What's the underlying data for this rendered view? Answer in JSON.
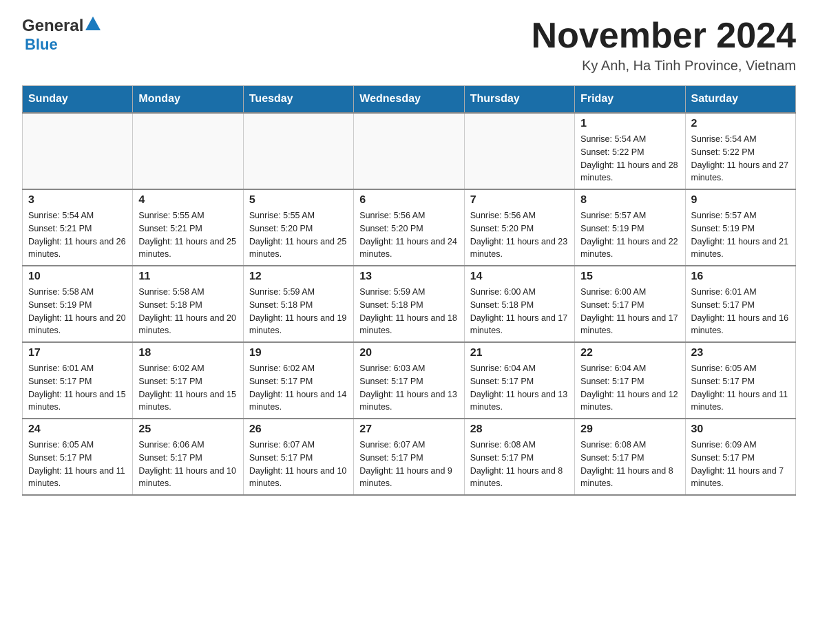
{
  "logo": {
    "general": "General",
    "blue": "Blue"
  },
  "header": {
    "month": "November 2024",
    "location": "Ky Anh, Ha Tinh Province, Vietnam"
  },
  "weekdays": [
    "Sunday",
    "Monday",
    "Tuesday",
    "Wednesday",
    "Thursday",
    "Friday",
    "Saturday"
  ],
  "weeks": [
    [
      {
        "day": "",
        "info": ""
      },
      {
        "day": "",
        "info": ""
      },
      {
        "day": "",
        "info": ""
      },
      {
        "day": "",
        "info": ""
      },
      {
        "day": "",
        "info": ""
      },
      {
        "day": "1",
        "info": "Sunrise: 5:54 AM\nSunset: 5:22 PM\nDaylight: 11 hours and 28 minutes."
      },
      {
        "day": "2",
        "info": "Sunrise: 5:54 AM\nSunset: 5:22 PM\nDaylight: 11 hours and 27 minutes."
      }
    ],
    [
      {
        "day": "3",
        "info": "Sunrise: 5:54 AM\nSunset: 5:21 PM\nDaylight: 11 hours and 26 minutes."
      },
      {
        "day": "4",
        "info": "Sunrise: 5:55 AM\nSunset: 5:21 PM\nDaylight: 11 hours and 25 minutes."
      },
      {
        "day": "5",
        "info": "Sunrise: 5:55 AM\nSunset: 5:20 PM\nDaylight: 11 hours and 25 minutes."
      },
      {
        "day": "6",
        "info": "Sunrise: 5:56 AM\nSunset: 5:20 PM\nDaylight: 11 hours and 24 minutes."
      },
      {
        "day": "7",
        "info": "Sunrise: 5:56 AM\nSunset: 5:20 PM\nDaylight: 11 hours and 23 minutes."
      },
      {
        "day": "8",
        "info": "Sunrise: 5:57 AM\nSunset: 5:19 PM\nDaylight: 11 hours and 22 minutes."
      },
      {
        "day": "9",
        "info": "Sunrise: 5:57 AM\nSunset: 5:19 PM\nDaylight: 11 hours and 21 minutes."
      }
    ],
    [
      {
        "day": "10",
        "info": "Sunrise: 5:58 AM\nSunset: 5:19 PM\nDaylight: 11 hours and 20 minutes."
      },
      {
        "day": "11",
        "info": "Sunrise: 5:58 AM\nSunset: 5:18 PM\nDaylight: 11 hours and 20 minutes."
      },
      {
        "day": "12",
        "info": "Sunrise: 5:59 AM\nSunset: 5:18 PM\nDaylight: 11 hours and 19 minutes."
      },
      {
        "day": "13",
        "info": "Sunrise: 5:59 AM\nSunset: 5:18 PM\nDaylight: 11 hours and 18 minutes."
      },
      {
        "day": "14",
        "info": "Sunrise: 6:00 AM\nSunset: 5:18 PM\nDaylight: 11 hours and 17 minutes."
      },
      {
        "day": "15",
        "info": "Sunrise: 6:00 AM\nSunset: 5:17 PM\nDaylight: 11 hours and 17 minutes."
      },
      {
        "day": "16",
        "info": "Sunrise: 6:01 AM\nSunset: 5:17 PM\nDaylight: 11 hours and 16 minutes."
      }
    ],
    [
      {
        "day": "17",
        "info": "Sunrise: 6:01 AM\nSunset: 5:17 PM\nDaylight: 11 hours and 15 minutes."
      },
      {
        "day": "18",
        "info": "Sunrise: 6:02 AM\nSunset: 5:17 PM\nDaylight: 11 hours and 15 minutes."
      },
      {
        "day": "19",
        "info": "Sunrise: 6:02 AM\nSunset: 5:17 PM\nDaylight: 11 hours and 14 minutes."
      },
      {
        "day": "20",
        "info": "Sunrise: 6:03 AM\nSunset: 5:17 PM\nDaylight: 11 hours and 13 minutes."
      },
      {
        "day": "21",
        "info": "Sunrise: 6:04 AM\nSunset: 5:17 PM\nDaylight: 11 hours and 13 minutes."
      },
      {
        "day": "22",
        "info": "Sunrise: 6:04 AM\nSunset: 5:17 PM\nDaylight: 11 hours and 12 minutes."
      },
      {
        "day": "23",
        "info": "Sunrise: 6:05 AM\nSunset: 5:17 PM\nDaylight: 11 hours and 11 minutes."
      }
    ],
    [
      {
        "day": "24",
        "info": "Sunrise: 6:05 AM\nSunset: 5:17 PM\nDaylight: 11 hours and 11 minutes."
      },
      {
        "day": "25",
        "info": "Sunrise: 6:06 AM\nSunset: 5:17 PM\nDaylight: 11 hours and 10 minutes."
      },
      {
        "day": "26",
        "info": "Sunrise: 6:07 AM\nSunset: 5:17 PM\nDaylight: 11 hours and 10 minutes."
      },
      {
        "day": "27",
        "info": "Sunrise: 6:07 AM\nSunset: 5:17 PM\nDaylight: 11 hours and 9 minutes."
      },
      {
        "day": "28",
        "info": "Sunrise: 6:08 AM\nSunset: 5:17 PM\nDaylight: 11 hours and 8 minutes."
      },
      {
        "day": "29",
        "info": "Sunrise: 6:08 AM\nSunset: 5:17 PM\nDaylight: 11 hours and 8 minutes."
      },
      {
        "day": "30",
        "info": "Sunrise: 6:09 AM\nSunset: 5:17 PM\nDaylight: 11 hours and 7 minutes."
      }
    ]
  ]
}
